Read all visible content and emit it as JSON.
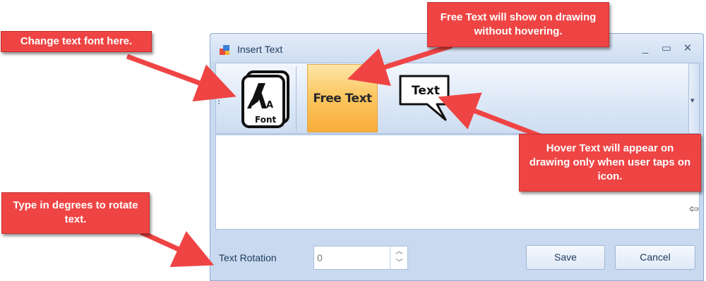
{
  "window": {
    "title": "Insert Text",
    "minimize": "_",
    "maximize": "▭",
    "close": "✕"
  },
  "toolbar": {
    "font_button": "Font",
    "free_text_button": "Free Text",
    "hover_text_button": "Text",
    "overflow": "▾"
  },
  "footer": {
    "rotation_label": "Text Rotation",
    "rotation_value": "0",
    "save_label": "Save",
    "cancel_label": "Cancel"
  },
  "callouts": {
    "font": "Change text font here.",
    "free_text": "Free Text will show on drawing without hovering.",
    "hover_text": "Hover Text will appear on drawing only when user taps on icon.",
    "rotation": "Type in degrees to rotate text."
  },
  "colors": {
    "callout": "#ef4444",
    "window_bg": "#c9daf0",
    "active_button": "#fbc863"
  }
}
